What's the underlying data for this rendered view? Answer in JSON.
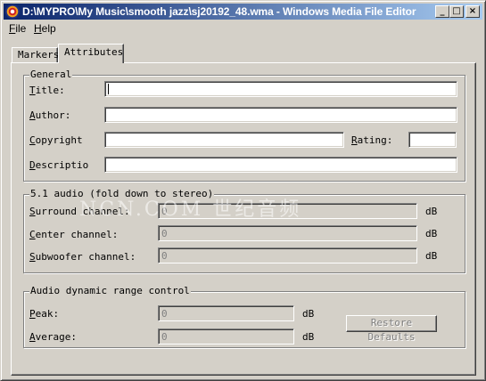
{
  "window": {
    "title": "D:\\MYPRO\\My Music\\smooth jazz\\sj20192_48.wma - Windows Media File Editor",
    "minimize_glyph": "_",
    "maximize_glyph": "□",
    "close_glyph": "×"
  },
  "menu": {
    "file": {
      "accel": "F",
      "rest": "ile"
    },
    "help": {
      "accel": "H",
      "rest": "elp"
    }
  },
  "tabs": {
    "markers": "Markers",
    "attributes": "Attributes"
  },
  "general": {
    "title": "General",
    "title_label": {
      "accel": "T",
      "rest": "itle:"
    },
    "author_label": {
      "accel": "A",
      "rest": "uthor:"
    },
    "copyright_label": {
      "accel": "C",
      "rest": "opyright"
    },
    "rating_label": {
      "accel": "R",
      "rest": "ating:"
    },
    "description_label": {
      "accel": "D",
      "rest": "escriptio"
    },
    "title_value": "",
    "author_value": "",
    "copyright_value": "",
    "rating_value": "",
    "description_value": ""
  },
  "surround": {
    "title": "5.1 audio (fold down to stereo)",
    "surround_label": {
      "accel": "S",
      "rest": "urround channel:"
    },
    "center_label": {
      "accel": "C",
      "rest": "enter channel:"
    },
    "subwoofer_label": {
      "accel": "S",
      "rest": "ubwoofer channel:"
    },
    "surround_value": "0",
    "center_value": "0",
    "subwoofer_value": "0",
    "unit": "dB"
  },
  "drc": {
    "title": "Audio dynamic range control",
    "peak_label": {
      "accel": "P",
      "rest": "eak:"
    },
    "average_label": {
      "accel": "A",
      "rest": "verage:"
    },
    "peak_value": "0",
    "average_value": "0",
    "unit": "dB",
    "restore_button": "Restore Defaults"
  },
  "watermark": "NCN.COM 世纪音频"
}
